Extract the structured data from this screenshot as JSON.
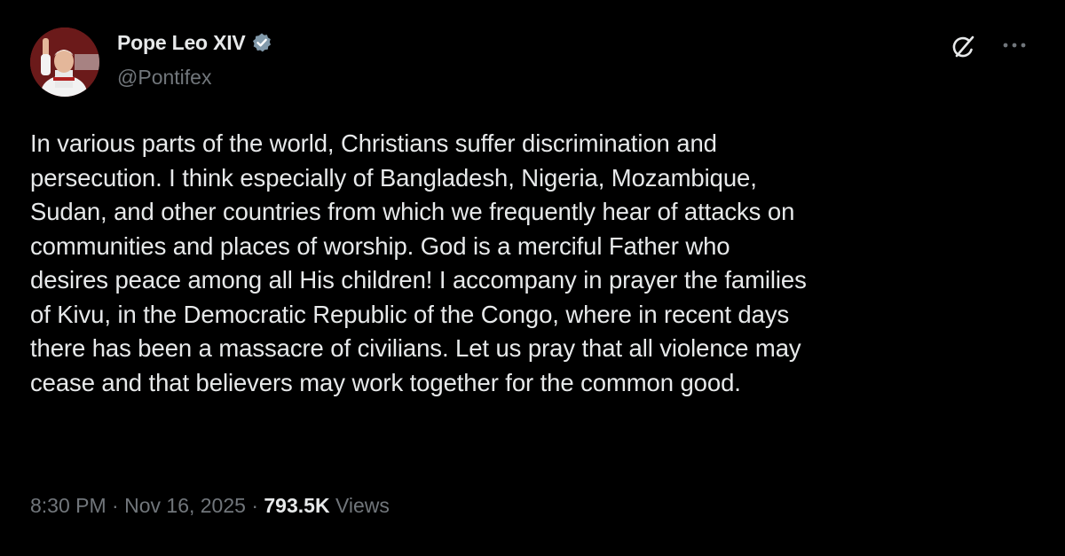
{
  "user": {
    "display_name": "Pope Leo XIV",
    "handle": "@Pontifex",
    "verified": true,
    "avatar_icon": "avatar-photo"
  },
  "actions": {
    "grok_icon": "grok-icon",
    "more_icon": "more-icon"
  },
  "tweet": {
    "text": "In various parts of the world, Christians suffer discrimination and\npersecution. I think especially of Bangladesh, Nigeria, Mozambique,\nSudan, and other countries from which we frequently hear of attacks on\ncommunities and places of worship. God is a merciful Father who\ndesires peace among all His children! I accompany in prayer the families\nof Kivu, in the Democratic Republic of the Congo, where in recent days\nthere has been a massacre of civilians. Let us pray that all violence may\ncease and that believers may work together for the common good."
  },
  "meta": {
    "time": "8:30 PM",
    "separator": " · ",
    "date": "Nov 16, 2025",
    "views_count": "793.5K",
    "views_label": " Views"
  },
  "colors": {
    "background": "#000000",
    "text_primary": "#e7e9ea",
    "text_secondary": "#71767b",
    "verified_blue": "#829aab"
  }
}
